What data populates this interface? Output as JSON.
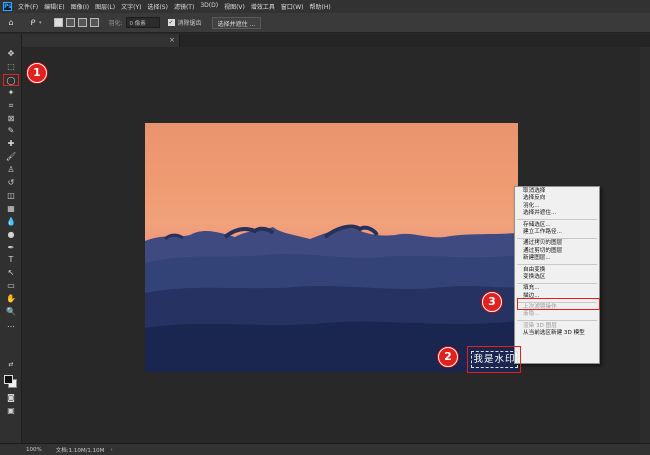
{
  "app": {
    "logo": "Ps"
  },
  "menu": [
    "文件(F)",
    "编辑(E)",
    "图像(I)",
    "图层(L)",
    "文字(Y)",
    "选择(S)",
    "滤镜(T)",
    "3D(D)",
    "视图(V)",
    "增效工具",
    "窗口(W)",
    "帮助(H)"
  ],
  "options": {
    "home_icon": "home-icon",
    "lasso_icon": "lasso-icon",
    "feather_label": "羽化:",
    "feather_value": "0 像素",
    "antialias_label": "消除锯齿",
    "antialias_checked": true,
    "select_mask_label": "选择并遮住 ..."
  },
  "tab": {
    "close": "×"
  },
  "tools": [
    "move-icon",
    "marquee-icon",
    "lasso-icon",
    "magic-wand-icon",
    "crop-icon",
    "frame-icon",
    "eyedropper-icon",
    "healing-brush-icon",
    "brush-icon",
    "clone-stamp-icon",
    "history-brush-icon",
    "eraser-icon",
    "gradient-icon",
    "blur-icon",
    "dodge-icon",
    "pen-icon",
    "type-icon",
    "path-selection-icon",
    "rectangle-icon",
    "hand-icon",
    "zoom-icon",
    "more-tools-icon"
  ],
  "tool_glyphs": [
    "✥",
    "⬚",
    "◯",
    "✦",
    "⌗",
    "⊠",
    "✎",
    "✚",
    "🖌",
    "♙",
    "↺",
    "◫",
    "▦",
    "💧",
    "●",
    "✒",
    "T",
    "↖",
    "▭",
    "✋",
    "🔍",
    "…"
  ],
  "colors": {
    "foreground": "#111111",
    "background": "#f1f1f1",
    "accent_red": "#e0211e"
  },
  "context_menu": [
    {
      "label": "取消选择",
      "enabled": true
    },
    {
      "label": "选择反向",
      "enabled": true
    },
    {
      "label": "羽化...",
      "enabled": true
    },
    {
      "label": "选择并遮住...",
      "enabled": true
    },
    {
      "sep": true
    },
    {
      "label": "存储选区...",
      "enabled": true
    },
    {
      "label": "建立工作路径...",
      "enabled": true
    },
    {
      "sep": true
    },
    {
      "label": "通过拷贝的图层",
      "enabled": true
    },
    {
      "label": "通过剪切的图层",
      "enabled": true
    },
    {
      "label": "新建图层...",
      "enabled": true
    },
    {
      "sep": true
    },
    {
      "label": "自由变换",
      "enabled": true
    },
    {
      "label": "变换选区",
      "enabled": true
    },
    {
      "sep": true
    },
    {
      "label": "填充...",
      "enabled": true
    },
    {
      "label": "描边...",
      "enabled": true
    },
    {
      "sep": true
    },
    {
      "label": "上次滤镜操作",
      "enabled": false
    },
    {
      "label": "渐隐...",
      "enabled": false
    },
    {
      "sep": true
    },
    {
      "label": "渲染 3D 图层",
      "enabled": false
    },
    {
      "label": "从当前选区新建 3D 模型",
      "enabled": true
    }
  ],
  "watermark": "我是水印",
  "badges": [
    "1",
    "2",
    "3"
  ],
  "status": {
    "zoom": "100%",
    "doc": "文档:1.10M/1.10M",
    "arrow": "›"
  }
}
